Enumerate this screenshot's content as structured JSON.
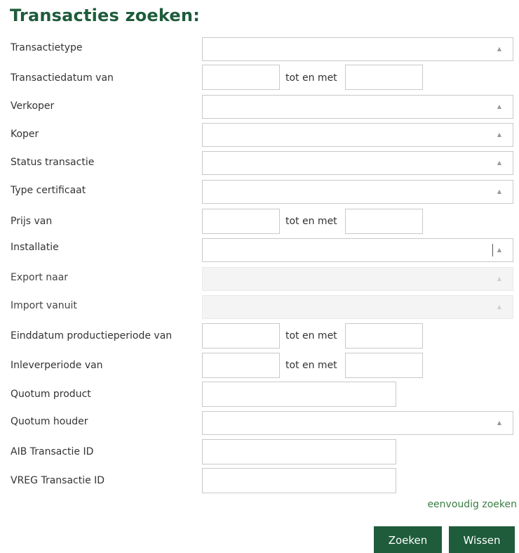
{
  "title": "Transacties zoeken:",
  "separator_text": "tot en met",
  "fields": {
    "transactietype": {
      "label": "Transactietype"
    },
    "transactiedatum": {
      "label": "Transactiedatum van",
      "between": "tot en met"
    },
    "verkoper": {
      "label": "Verkoper"
    },
    "koper": {
      "label": "Koper"
    },
    "status": {
      "label": "Status transactie"
    },
    "type_certificaat": {
      "label": "Type certificaat"
    },
    "prijs": {
      "label": "Prijs van",
      "between": "tot en met"
    },
    "installatie": {
      "label": "Installatie"
    },
    "export_naar": {
      "label": "Export naar"
    },
    "import_vanuit": {
      "label": "Import vanuit"
    },
    "einddatum": {
      "label": "Einddatum productieperiode van",
      "between": "tot en met"
    },
    "inleverperiode": {
      "label": "Inleverperiode van",
      "between": "tot en met"
    },
    "quotum_product": {
      "label": "Quotum product"
    },
    "quotum_houder": {
      "label": "Quotum houder"
    },
    "aib_id": {
      "label": "AIB Transactie ID"
    },
    "vreg_id": {
      "label": "VREG Transactie ID"
    }
  },
  "links": {
    "simple_search": "eenvoudig zoeken"
  },
  "buttons": {
    "search": "Zoeken",
    "clear": "Wissen"
  },
  "icons": {
    "dropdown": "▲"
  },
  "colors": {
    "accent": "#1e5c3b",
    "link": "#3a7d44",
    "border": "#c9c9c9",
    "disabled_bg": "#f4f4f4"
  }
}
